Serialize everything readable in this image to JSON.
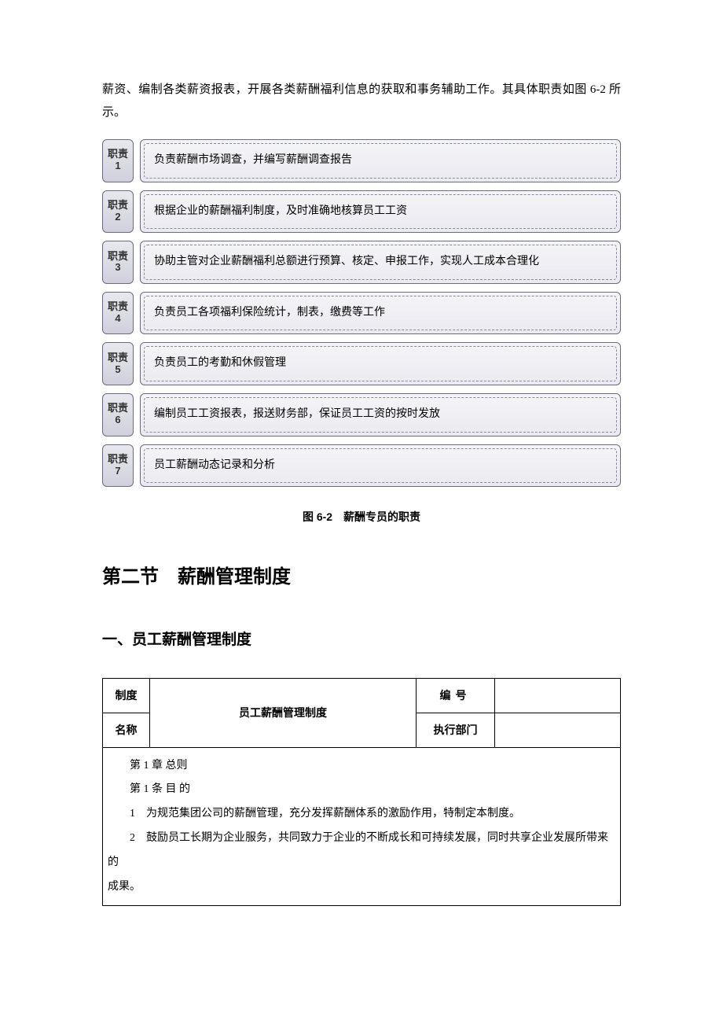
{
  "intro": "薪资、编制各类薪资报表，开展各类薪酬福利信息的获取和事务辅助工作。其具体职责如图 6-2 所示。",
  "duties": [
    {
      "label_prefix": "职责",
      "num": "1",
      "text": "负责薪酬市场调查，并编写薪酬调查报告"
    },
    {
      "label_prefix": "职责",
      "num": "2",
      "text": "根据企业的薪酬福利制度，及时准确地核算员工工资"
    },
    {
      "label_prefix": "职责",
      "num": "3",
      "text": "协助主管对企业薪酬福利总额进行预算、核定、申报工作，实现人工成本合理化"
    },
    {
      "label_prefix": "职责",
      "num": "4",
      "text": "负责员工各项福利保险统计，制表，缴费等工作"
    },
    {
      "label_prefix": "职责",
      "num": "5",
      "text": "负责员工的考勤和休假管理"
    },
    {
      "label_prefix": "职责",
      "num": "6",
      "text": "编制员工工资报表，报送财务部，保证员工工资的按时发放"
    },
    {
      "label_prefix": "职责",
      "num": "7",
      "text": "员工薪酬动态记录和分析"
    }
  ],
  "figure_caption": "图 6-2　薪酬专员的职责",
  "section_heading": "第二节　薪酬管理制度",
  "sub_heading": "一、员工薪酬管理制度",
  "policy_table": {
    "row1_label": "制度",
    "row2_label": "名称",
    "title": "员工薪酬管理制度",
    "number_label": "编号",
    "number_value": "",
    "dept_label": "执行部门",
    "dept_value": ""
  },
  "body_paragraphs": {
    "p1": "第 1 章  总则",
    "p2": "第 1 条  目 的",
    "p3": "1　为规范集团公司的薪酬管理，充分发挥薪酬体系的激励作用，特制定本制度。",
    "p4": "2　鼓励员工长期为企业服务，共同致力于企业的不断成长和可持续发展，同时共享企业发展所带来的",
    "p5": "成果。"
  }
}
